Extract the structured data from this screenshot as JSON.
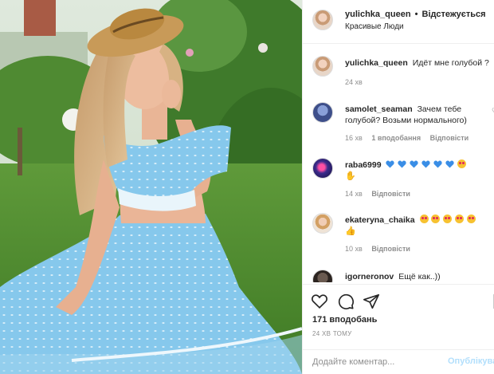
{
  "post": {
    "author": "yulichka_queen",
    "follow_label": "Відстежується",
    "location": "Красивые Люди",
    "photo_description_icon": "photo"
  },
  "comments": [
    {
      "user": "yulichka_queen",
      "text": "Идёт мне голубой ?",
      "time": "24 хв",
      "likes": "",
      "reply": ""
    },
    {
      "user": "samolet_seaman",
      "text": "Зачем тебе голубой? Возьми нормального)",
      "time": "16 хв",
      "likes": "1 вподобання",
      "reply": "Відповісти"
    },
    {
      "user": "raba6999",
      "text": "",
      "emojis": [
        "blue-heart",
        "blue-heart",
        "blue-heart",
        "blue-heart",
        "blue-heart",
        "blue-heart",
        "heart-eyes-face",
        "clapping-hand"
      ],
      "time": "14 хв",
      "reply": "Відповісти"
    },
    {
      "user": "ekateryna_chaika",
      "text": "",
      "emojis": [
        "heart-eyes-face",
        "heart-eyes-face",
        "heart-eyes-face",
        "heart-eyes-face",
        "heart-eyes-face",
        "thumbs-up"
      ],
      "time": "10 хв",
      "reply": "Відповісти"
    },
    {
      "user": "igorneronov",
      "text": "Ещё как..))",
      "time": "",
      "reply": ""
    }
  ],
  "actions": {
    "likes": "171 вподобань",
    "ago": "24 ХВ ТОМУ",
    "icons": [
      "heart-icon",
      "comment-icon",
      "share-icon",
      "bookmark-icon"
    ]
  },
  "add_comment": {
    "placeholder": "Додайте коментар...",
    "post_label": "Опублікувати"
  },
  "colors": {
    "text": "#262626",
    "muted": "#8e8e8e",
    "link_disabled": "#b2dffc",
    "blue_heart": "#3a8ee6",
    "dress": "#7fc6ea"
  }
}
